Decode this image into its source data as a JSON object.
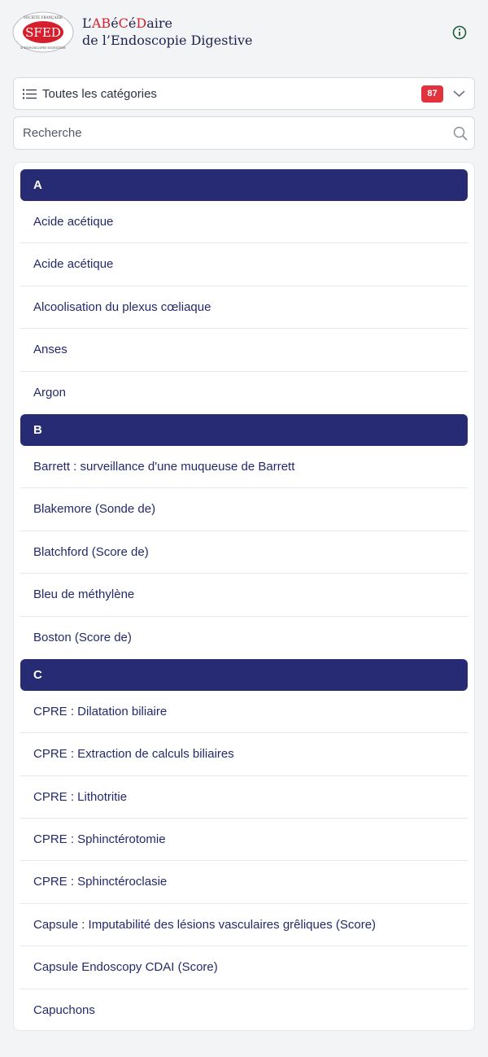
{
  "header": {
    "logo_text": "SFED",
    "logo_ring_top": "SOCIÉTÉ FRANÇAISE",
    "logo_ring_bottom": "D'ENDOSCOPIE DIGESTIVE",
    "title_line1_parts": [
      "L’",
      "AB",
      "é",
      "C",
      "é",
      "D",
      "aire"
    ],
    "title_line2": "de l’Endoscopie Digestive",
    "info_icon": "info-circle-icon"
  },
  "category_filter": {
    "label": "Toutes les catégories",
    "count": "87",
    "icon": "list-icon",
    "chevron": "chevron-down-icon"
  },
  "search": {
    "placeholder": "Recherche",
    "value": "",
    "icon": "search-icon"
  },
  "sections": [
    {
      "letter": "A",
      "items": [
        "Acide acétique",
        "Acide acétique",
        "Alcoolisation du plexus cœliaque",
        "Anses",
        "Argon"
      ]
    },
    {
      "letter": "B",
      "items": [
        "Barrett : surveillance d'une muqueuse de Barrett",
        "Blakemore (Sonde de)",
        "Blatchford (Score de)",
        "Bleu de méthylène",
        "Boston (Score de)"
      ]
    },
    {
      "letter": "C",
      "items": [
        "CPRE : Dilatation biliaire",
        "CPRE : Extraction de calculs biliaires",
        "CPRE : Lithotritie",
        "CPRE : Sphinctérotomie",
        "CPRE : Sphinctéroclasie",
        "Capsule : Imputabilité des lésions vasculaires grêliques (Score)",
        "Capsule Endoscopy CDAI (Score)",
        "Capuchons"
      ]
    }
  ],
  "colors": {
    "section_header_bg": "#262b74",
    "brand_red": "#d51f2c",
    "badge_bg": "#e0333d",
    "item_text": "#232a6b"
  }
}
